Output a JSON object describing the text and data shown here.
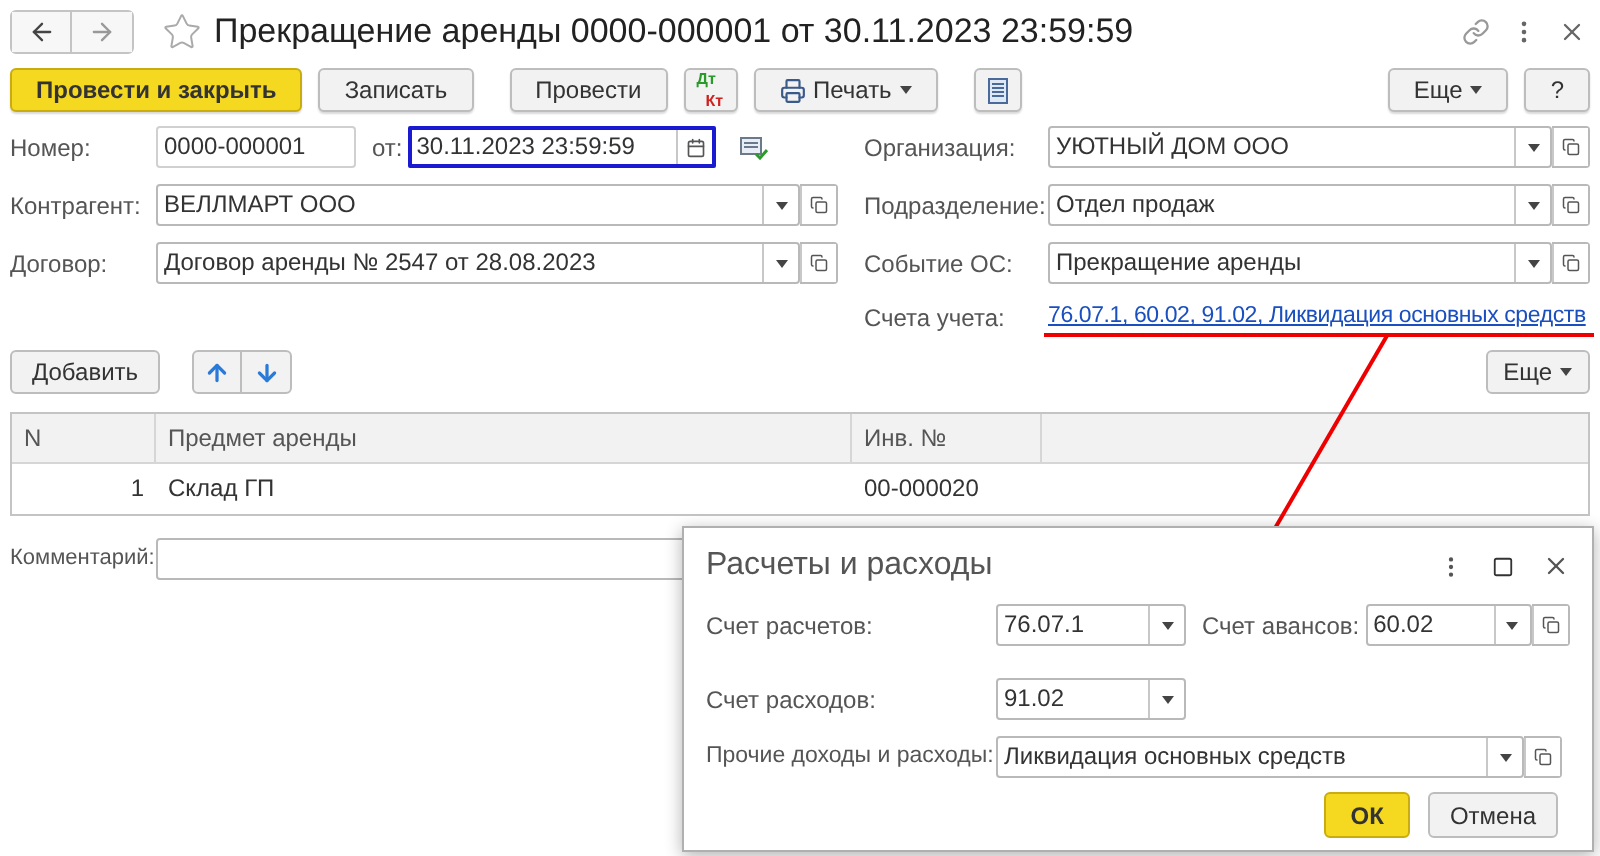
{
  "window": {
    "title": "Прекращение аренды 0000-000001 от 30.11.2023 23:59:59"
  },
  "toolbar": [
    {
      "kind": "primary",
      "label": "Провести и закрыть"
    },
    {
      "kind": "plain",
      "label": "Записать"
    },
    {
      "kind": "plain",
      "label": "Провести"
    },
    {
      "kind": "dtkt",
      "label": "Дт",
      "label2": "Кт"
    },
    {
      "kind": "print",
      "label": "Печать"
    },
    {
      "kind": "report"
    }
  ],
  "toolbar_right": [
    {
      "kind": "menu",
      "label": "Еще"
    },
    {
      "kind": "plain",
      "label": "?"
    }
  ],
  "number": {
    "label": "Номер:",
    "value": "0000-000001"
  },
  "date": {
    "label": "от:",
    "value": "30.11.2023 23:59:59",
    "focused": true
  },
  "fields_left": [
    {
      "label": "Контрагент:",
      "value": "ВЕЛЛМАРТ ООО"
    },
    {
      "label": "Договор:",
      "value": "Договор аренды № 2547 от 28.08.2023"
    }
  ],
  "fields_right": [
    {
      "label": "Организация:",
      "value": "УЮТНЫЙ ДОМ ООО"
    },
    {
      "label": "Подразделение:",
      "value": "Отдел продаж"
    },
    {
      "label": "Событие ОС:",
      "value": "Прекращение аренды"
    }
  ],
  "accounts": {
    "label": "Счета учета:",
    "link": "76.07.1, 60.02, 91.02, Ликвидация основных средств"
  },
  "table_toolbar": {
    "add": "Добавить",
    "more": "Еще"
  },
  "table": {
    "columns": [
      "N",
      "Предмет аренды",
      "Инв. №"
    ],
    "rows": [
      {
        "cells": [
          "1",
          "Склад ГП",
          "00-000020"
        ]
      }
    ]
  },
  "comment": {
    "label": "Комментарий:"
  },
  "dialog": {
    "title": "Расчеты и расходы",
    "fields": [
      {
        "label": "Счет расчетов:",
        "value": "76.07.1",
        "open": false
      },
      {
        "label": "Счет авансов:",
        "value": "60.02",
        "open": true
      },
      {
        "label": "Счет расходов:",
        "value": "91.02",
        "open": false
      },
      {
        "label": "Прочие доходы и расходы:",
        "value": "Ликвидация основных средств",
        "open": true
      }
    ],
    "buttons": [
      {
        "kind": "primary",
        "label": "ОК"
      },
      {
        "kind": "plain",
        "label": "Отмена"
      }
    ]
  }
}
